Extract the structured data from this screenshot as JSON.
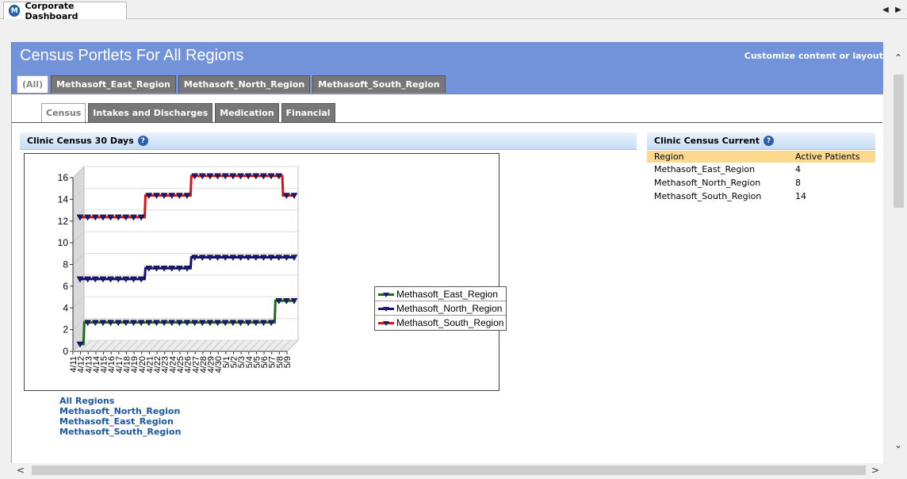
{
  "window": {
    "tab_title": "Corporate Dashboard",
    "logo_letter": "M",
    "nav_prev": "◀",
    "nav_next": "▶"
  },
  "header": {
    "title": "Census Portlets For All Regions",
    "customize_link": "Customize content or layout"
  },
  "region_tabs": [
    {
      "label": "(All)",
      "active": true
    },
    {
      "label": "Methasoft_East_Region",
      "active": false
    },
    {
      "label": "Methasoft_North_Region",
      "active": false
    },
    {
      "label": "Methasoft_South_Region",
      "active": false
    }
  ],
  "sub_tabs": [
    {
      "label": "Census",
      "active": true
    },
    {
      "label": "Intakes and Discharges",
      "active": false
    },
    {
      "label": "Medication",
      "active": false
    },
    {
      "label": "Financial",
      "active": false
    }
  ],
  "portlet_chart": {
    "title": "Clinic Census 30 Days",
    "help_icon": "?"
  },
  "portlet_table": {
    "title": "Clinic Census Current",
    "help_icon": "?",
    "columns": [
      "Region",
      "Active Patients"
    ],
    "rows": [
      [
        "Methasoft_East_Region",
        "4"
      ],
      [
        "Methasoft_North_Region",
        "8"
      ],
      [
        "Methasoft_South_Region",
        "14"
      ]
    ]
  },
  "region_links": [
    "All Regions",
    "Methasoft_North_Region",
    "Methasoft_East_Region",
    "Methasoft_South_Region"
  ],
  "chart_data": {
    "type": "line",
    "title": "",
    "xlabel": "",
    "ylabel": "",
    "ylim": [
      0,
      16
    ],
    "yticks": [
      0,
      2,
      4,
      6,
      8,
      10,
      12,
      14,
      16
    ],
    "grid": true,
    "three_d": true,
    "legend_position": "right",
    "categories": [
      "4/11",
      "4/12",
      "4/13",
      "4/14",
      "4/15",
      "4/16",
      "4/17",
      "4/18",
      "4/19",
      "4/20",
      "4/21",
      "4/22",
      "4/23",
      "4/24",
      "4/25",
      "4/26",
      "4/27",
      "4/28",
      "4/29",
      "4/30",
      "5/1",
      "5/2",
      "5/3",
      "5/4",
      "5/5",
      "5/6",
      "5/7",
      "5/8",
      "5/9"
    ],
    "series": [
      {
        "name": "Methasoft_East_Region",
        "color": "#1e6b1e",
        "values": [
          0,
          2,
          2,
          2,
          2,
          2,
          2,
          2,
          2,
          2,
          2,
          2,
          2,
          2,
          2,
          2,
          2,
          2,
          2,
          2,
          2,
          2,
          2,
          2,
          2,
          2,
          4,
          4,
          4
        ]
      },
      {
        "name": "Methasoft_North_Region",
        "color": "#141478",
        "values": [
          6,
          6,
          6,
          6,
          6,
          6,
          6,
          6,
          6,
          7,
          7,
          7,
          7,
          7,
          7,
          8,
          8,
          8,
          8,
          8,
          8,
          8,
          8,
          8,
          8,
          8,
          8,
          8,
          8
        ]
      },
      {
        "name": "Methasoft_South_Region",
        "color": "#e01010",
        "values": [
          11.7,
          11.7,
          11.7,
          11.7,
          11.7,
          11.7,
          11.7,
          11.7,
          11.7,
          13.7,
          13.7,
          13.7,
          13.7,
          13.7,
          13.7,
          15.5,
          15.5,
          15.5,
          15.5,
          15.5,
          15.5,
          15.5,
          15.5,
          15.5,
          15.5,
          15.5,
          15.5,
          13.7,
          13.7
        ]
      }
    ]
  },
  "scroll": {
    "up": "⌃",
    "down": "⌄",
    "left": "<",
    "right": ">"
  }
}
